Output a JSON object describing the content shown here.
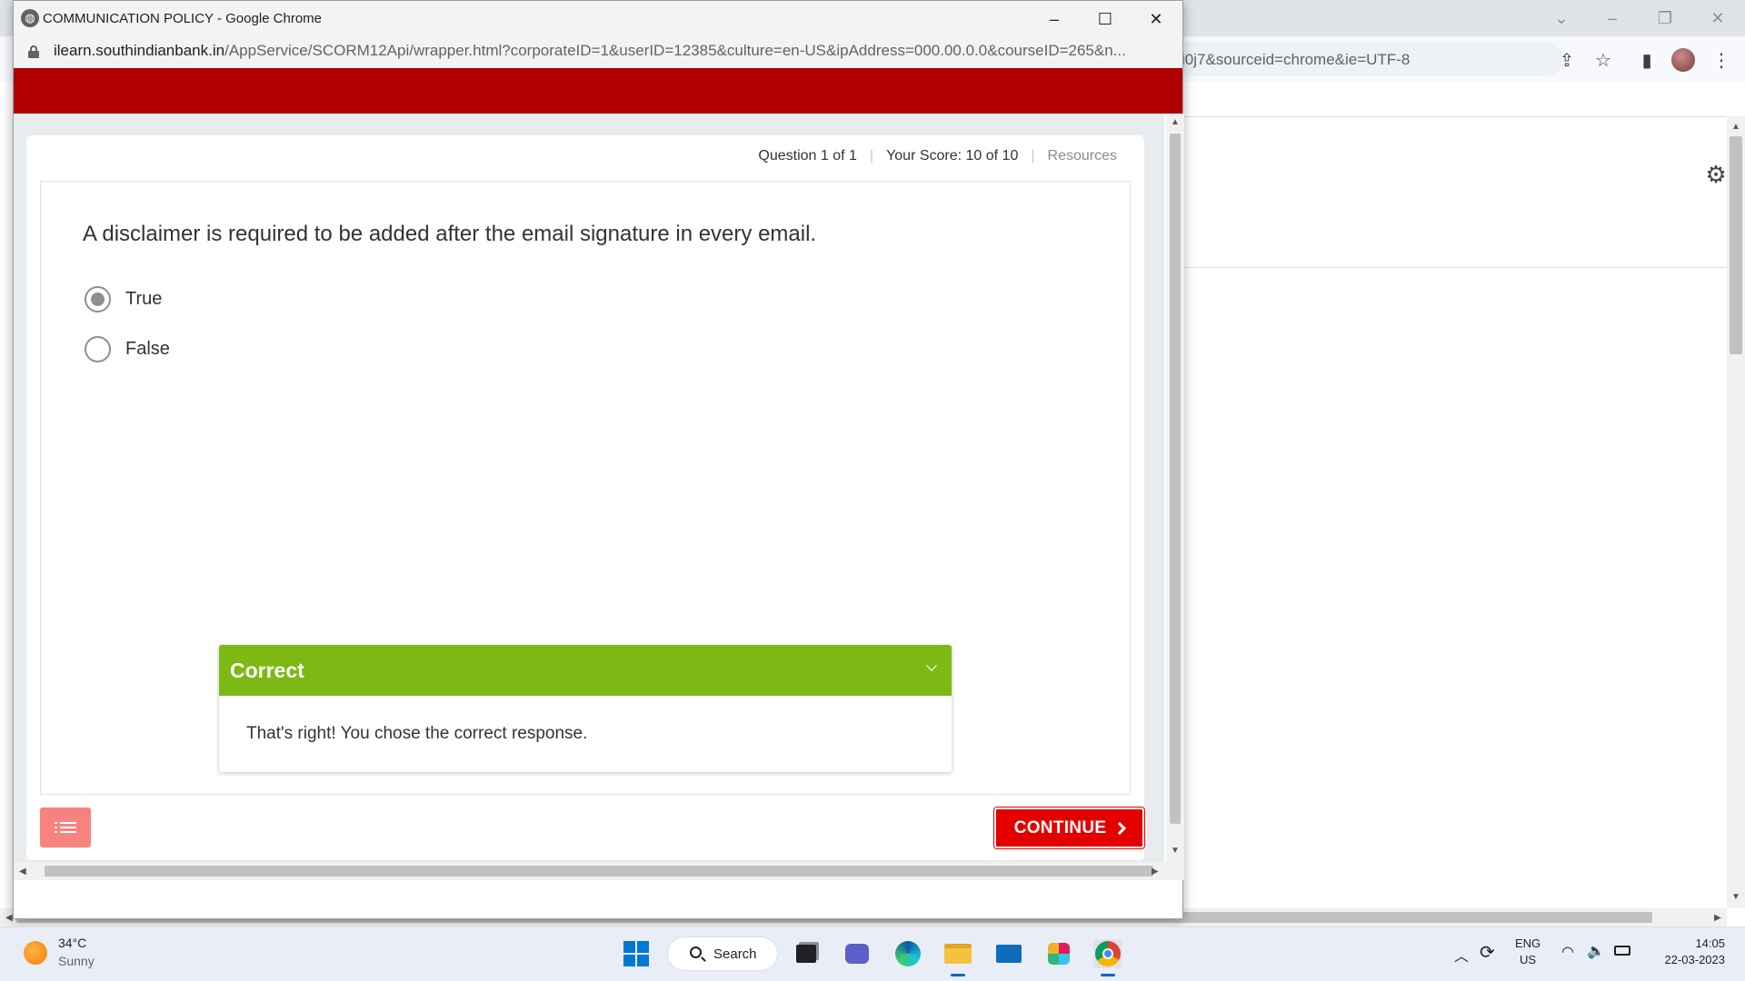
{
  "background_browser": {
    "url_fragment": "i0j7&sourceid=chrome&ie=UTF-8"
  },
  "popup": {
    "title": "COMMUNICATION POLICY - Google Chrome",
    "url_host": "ilearn.southindianbank.in",
    "url_path": "/AppService/SCORM12Api/wrapper.html?corporateID=1&userID=12385&culture=en-US&ipAddress=000.00.0.0&courseID=265&n..."
  },
  "quiz": {
    "question_counter": "Question 1 of 1",
    "score": "Your Score: 10 of 10",
    "resources": "Resources",
    "question": "A disclaimer is required to be added after the email signature in every email.",
    "options": [
      {
        "label": "True",
        "selected": true
      },
      {
        "label": "False",
        "selected": false
      }
    ],
    "feedback": {
      "title": "Correct",
      "message": "That's right! You chose the correct response."
    },
    "continue_label": "CONTINUE"
  },
  "colors": {
    "banner": "#b00000",
    "feedback_header": "#7db914",
    "continue": "#e50000",
    "menu_button": "#f7827e"
  },
  "taskbar": {
    "weather_temp": "34°C",
    "weather_condition": "Sunny",
    "search_label": "Search",
    "language_line1": "ENG",
    "language_line2": "US",
    "time": "14:05",
    "date": "22-03-2023"
  }
}
